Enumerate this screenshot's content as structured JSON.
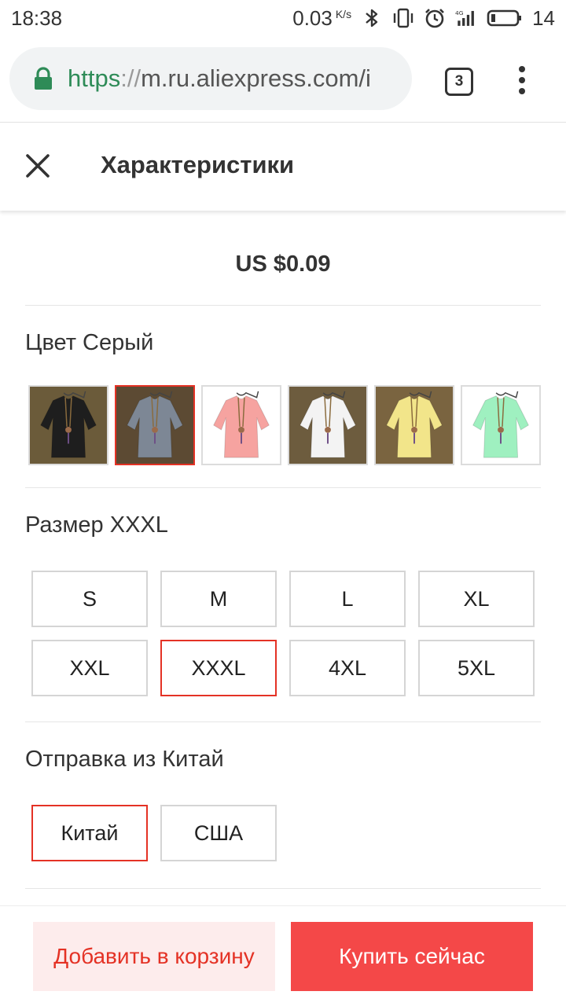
{
  "status_bar": {
    "time": "18:38",
    "speed": "0.03",
    "speed_unit": "K/s",
    "battery": "14"
  },
  "browser": {
    "url_scheme": "https",
    "url_sep": "://",
    "url_host": "m.ru.aliexpress.com/i",
    "tab_count": "3"
  },
  "header": {
    "title": "Характеристики"
  },
  "product": {
    "price": "US $0.09"
  },
  "color": {
    "label": "Цвет Серый",
    "swatches": [
      {
        "name": "black",
        "bg": "#6b5b3a",
        "shirt": "#1e1e1e"
      },
      {
        "name": "gray",
        "bg": "#5c4a33",
        "shirt": "#7d8795",
        "selected": true
      },
      {
        "name": "pink",
        "bg": "#ffffff",
        "shirt": "#f6a3a0"
      },
      {
        "name": "white",
        "bg": "#6d5c3e",
        "shirt": "#f3f3f3"
      },
      {
        "name": "yellow",
        "bg": "#7a6440",
        "shirt": "#f2e58a"
      },
      {
        "name": "mint",
        "bg": "#ffffff",
        "shirt": "#9ff0c0"
      }
    ]
  },
  "size": {
    "label": "Размер XXXL",
    "options": [
      "S",
      "M",
      "L",
      "XL",
      "XXL",
      "XXXL",
      "4XL",
      "5XL"
    ],
    "selected": "XXXL"
  },
  "shipping": {
    "label": "Отправка из Китай",
    "options": [
      "Китай",
      "США"
    ],
    "selected": "Китай"
  },
  "actions": {
    "add_to_cart": "Добавить в корзину",
    "buy_now": "Купить сейчас"
  },
  "colors": {
    "accent": "#e43225",
    "buy_bg": "#f44848",
    "cart_bg": "#fdecec",
    "url_green": "#2e8b57"
  }
}
